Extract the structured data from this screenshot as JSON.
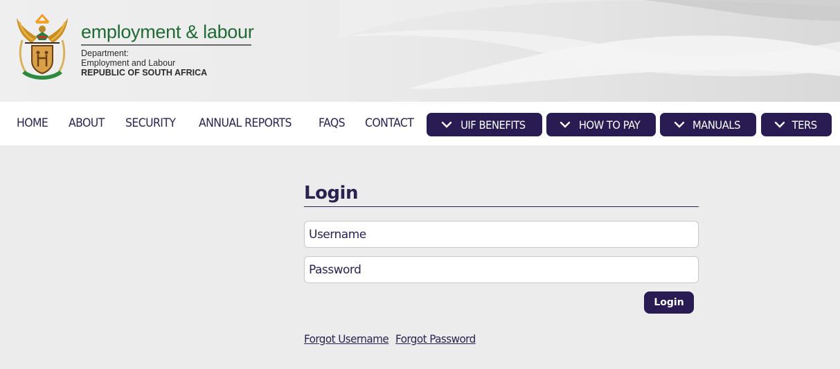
{
  "header": {
    "brand_title": "employment & labour",
    "dept_label": "Department:",
    "dept_name": "Employment and Labour",
    "country": "REPUBLIC OF SOUTH AFRICA",
    "logo": "south-africa-coat-of-arms-icon",
    "brand_color": "#1f6a35"
  },
  "nav": {
    "links": [
      {
        "label": "HOME"
      },
      {
        "label": "ABOUT"
      },
      {
        "label": "SECURITY"
      },
      {
        "label": "ANNUAL REPORTS"
      },
      {
        "label": "FAQS"
      },
      {
        "label": "CONTACT"
      }
    ],
    "dropdowns": [
      {
        "label": "UIF BENEFITS",
        "icon": "chevron-down-icon"
      },
      {
        "label": "HOW TO PAY",
        "icon": "chevron-down-icon"
      },
      {
        "label": "MANUALS",
        "icon": "chevron-down-icon"
      },
      {
        "label": "TERS",
        "icon": "chevron-down-icon"
      }
    ],
    "accent_color": "#281c52"
  },
  "login": {
    "title": "Login",
    "username": {
      "value": "",
      "placeholder": "Username"
    },
    "password": {
      "value": "",
      "placeholder": "Password"
    },
    "submit_label": "Login",
    "forgot_username": "Forgot Username",
    "forgot_password": "Forgot Password"
  }
}
